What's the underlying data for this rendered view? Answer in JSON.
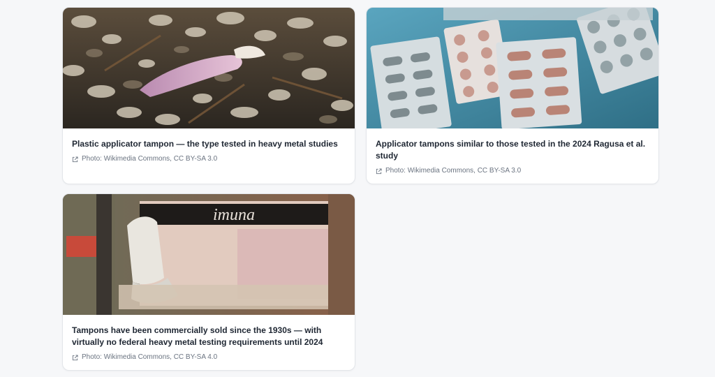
{
  "cards": [
    {
      "title": "Plastic applicator tampon — the type tested in heavy metal studies",
      "credit": "Photo: Wikimedia Commons, CC BY-SA 3.0"
    },
    {
      "title": "Applicator tampons similar to those tested in the 2024 Ragusa et al. study",
      "credit": "Photo: Wikimedia Commons, CC BY-SA 3.0"
    },
    {
      "title": "Tampons have been commercially sold since the 1930s — with virtually no federal heavy metal testing requirements until 2024",
      "credit": "Photo: Wikimedia Commons, CC BY-SA 4.0",
      "image_text": "imuna"
    }
  ],
  "icons": {
    "credit": "external-link-icon"
  },
  "colors": {
    "background": "#f6f7f9",
    "card": "#ffffff",
    "title": "#1f2733",
    "credit": "#6a7380"
  }
}
